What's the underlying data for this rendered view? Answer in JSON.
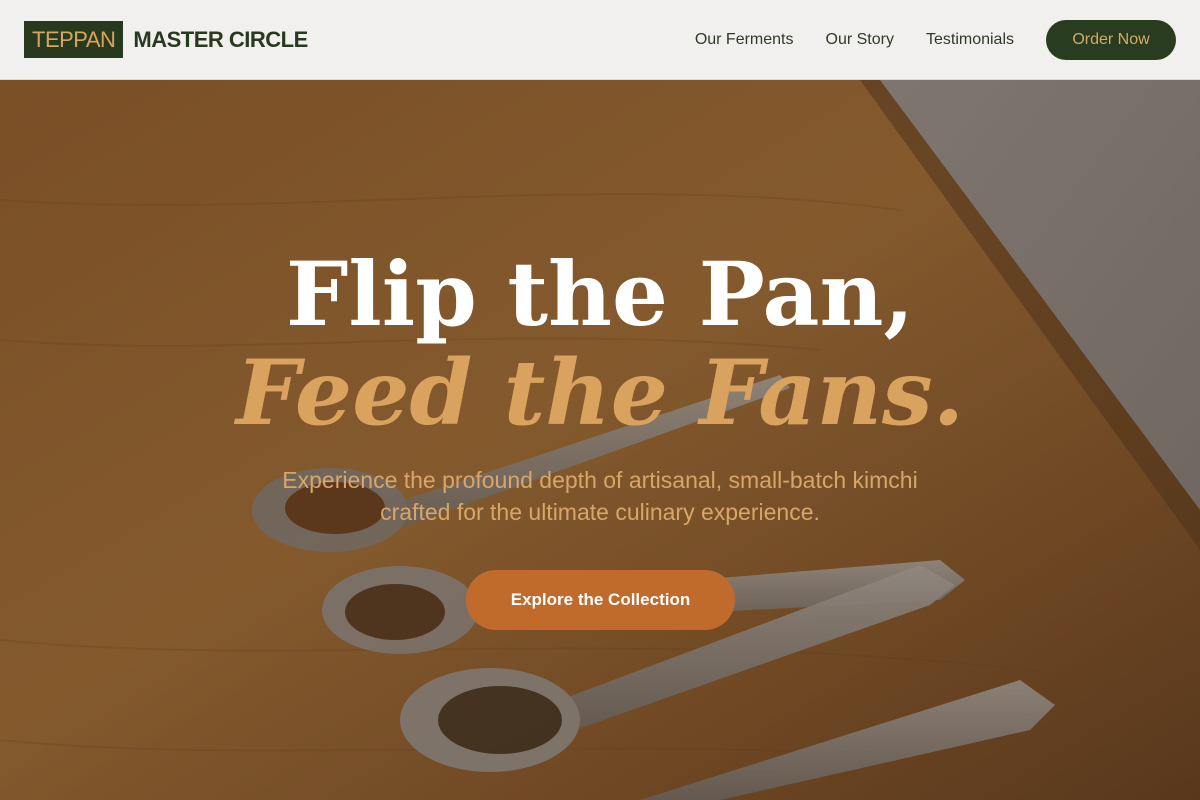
{
  "header": {
    "logo_box": "TEPPAN",
    "logo_text": "MASTER CIRCLE",
    "nav": [
      "Our Ferments",
      "Our Story",
      "Testimonials"
    ],
    "order_label": "Order Now"
  },
  "hero": {
    "headline_1": "Flip the Pan,",
    "headline_2": "Feed the Fans.",
    "subtitle": "Experience the profound depth of artisanal, small-batch kimchi crafted for the ultimate culinary experience.",
    "cta_label": "Explore the Collection"
  },
  "colors": {
    "header_bg": "#f1f0ee",
    "brand_green": "#283c1f",
    "accent_gold": "#d9a25f",
    "cta_orange": "#c06a2b"
  }
}
